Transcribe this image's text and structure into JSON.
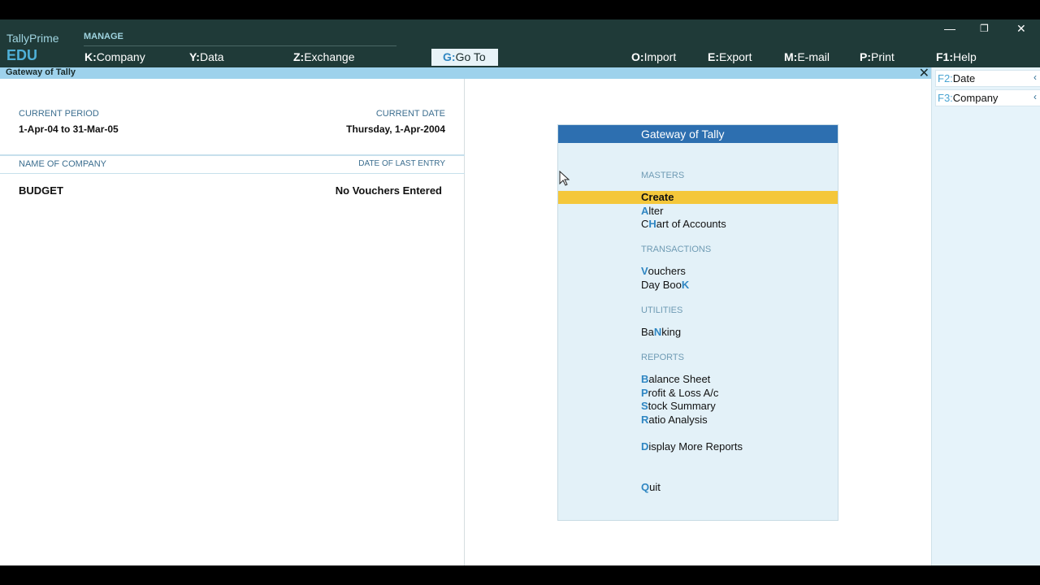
{
  "brand": {
    "line1": "TallyPrime",
    "line2": "EDU"
  },
  "header": {
    "manage_label": "MANAGE",
    "menu": [
      {
        "key": "K:",
        "label": "Company"
      },
      {
        "key": "Y:",
        "label": "Data"
      },
      {
        "key": "Z:",
        "label": "Exchange"
      }
    ],
    "goto": {
      "key": "G:",
      "label": "Go To"
    },
    "right_menu": [
      {
        "key": "O:",
        "label": "Import"
      },
      {
        "key": "E:",
        "label": "Export"
      },
      {
        "key": "M:",
        "label": "E-mail"
      },
      {
        "key": "P:",
        "label": "Print"
      },
      {
        "key": "F1:",
        "label": "Help"
      }
    ],
    "window_controls": {
      "minimize": "—",
      "restore": "❐",
      "close": "✕"
    }
  },
  "title_strip": {
    "title": "Gateway of Tally",
    "close": "✕"
  },
  "left_panel": {
    "current_period_label": "CURRENT PERIOD",
    "current_period_value": "1-Apr-04 to 31-Mar-05",
    "current_date_label": "CURRENT DATE",
    "current_date_value": "Thursday, 1-Apr-2004",
    "company_col_label": "NAME OF COMPANY",
    "last_entry_col_label": "DATE OF LAST ENTRY",
    "company_name": "BUDGET",
    "last_entry": "No Vouchers Entered"
  },
  "gateway": {
    "title": "Gateway of Tally",
    "sections": {
      "masters": "MASTERS",
      "transactions": "TRANSACTIONS",
      "utilities": "UTILITIES",
      "reports": "REPORTS"
    },
    "items": {
      "create": {
        "hk": "C",
        "rest": "reate"
      },
      "alter": {
        "hk": "A",
        "rest": "lter"
      },
      "coa": {
        "pre": "C",
        "hk": "H",
        "rest": "art of Accounts"
      },
      "vouchers": {
        "hk": "V",
        "rest": "ouchers"
      },
      "daybook": {
        "pre": "Day Boo",
        "hk": "K"
      },
      "banking": {
        "pre": "Ba",
        "hk": "N",
        "rest": "king"
      },
      "balance": {
        "hk": "B",
        "rest": "alance Sheet"
      },
      "pl": {
        "hk": "P",
        "rest": "rofit & Loss A/c"
      },
      "stock": {
        "hk": "S",
        "rest": "tock Summary"
      },
      "ratio": {
        "hk": "R",
        "rest": "atio Analysis"
      },
      "more": {
        "hk": "D",
        "rest": "isplay More Reports"
      },
      "quit": {
        "hk": "Q",
        "rest": "uit"
      }
    },
    "selected": "Create"
  },
  "right_bar": [
    {
      "key": "F2:",
      "label": "Date",
      "chev": "‹"
    },
    {
      "key": "F3:",
      "label": "Company",
      "chev": "‹"
    }
  ],
  "colors": {
    "header_bg": "#1f3a38",
    "accent_blue": "#2d6fb0",
    "selection": "#f4c73b",
    "title_strip": "#9ed2ec"
  }
}
